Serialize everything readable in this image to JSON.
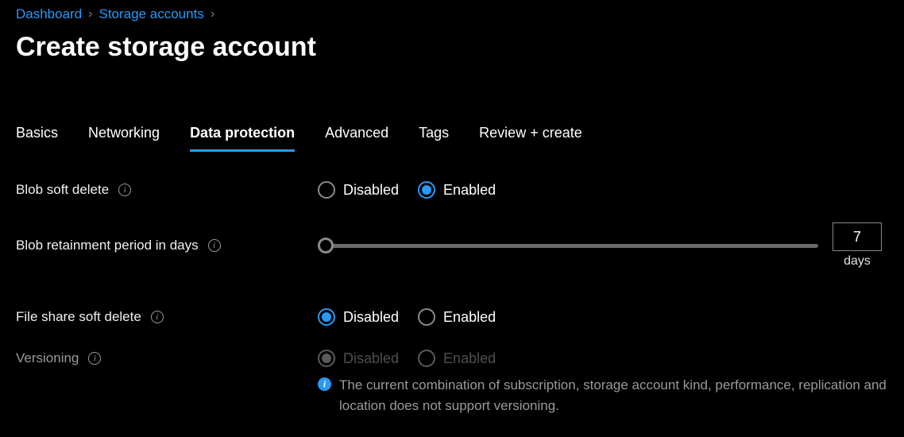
{
  "breadcrumb": {
    "items": [
      "Dashboard",
      "Storage accounts"
    ]
  },
  "title": "Create storage account",
  "tabs": [
    {
      "label": "Basics",
      "active": false
    },
    {
      "label": "Networking",
      "active": false
    },
    {
      "label": "Data protection",
      "active": true
    },
    {
      "label": "Advanced",
      "active": false
    },
    {
      "label": "Tags",
      "active": false
    },
    {
      "label": "Review + create",
      "active": false
    }
  ],
  "fields": {
    "blobSoftDelete": {
      "label": "Blob soft delete",
      "options": {
        "disabled": "Disabled",
        "enabled": "Enabled"
      },
      "value": "enabled"
    },
    "blobRetainment": {
      "label": "Blob retainment period in days",
      "value": "7",
      "unit": "days"
    },
    "fileShareSoftDelete": {
      "label": "File share soft delete",
      "options": {
        "disabled": "Disabled",
        "enabled": "Enabled"
      },
      "value": "disabled"
    },
    "versioning": {
      "label": "Versioning",
      "options": {
        "disabled": "Disabled",
        "enabled": "Enabled"
      },
      "value": "disabled",
      "disabled": true,
      "warning": "The current combination of subscription, storage account kind, performance, replication and location does not support versioning."
    }
  }
}
